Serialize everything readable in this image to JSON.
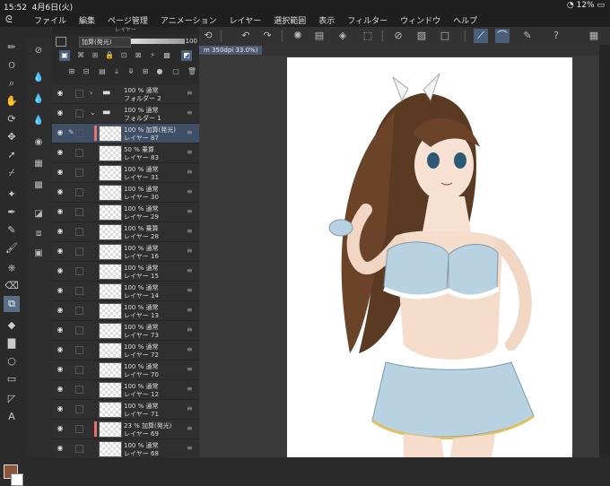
{
  "status": {
    "time": "15:52",
    "date": "4月6日(火)",
    "wifi_icon": "wifi-icon",
    "battery": "12%"
  },
  "menubar": {
    "logo_icon": "clip-studio-logo-icon",
    "items": [
      "ファイル",
      "編集",
      "ページ管理",
      "アニメーション",
      "レイヤー",
      "選択範囲",
      "表示",
      "フィルター",
      "ウィンドウ",
      "ヘルプ"
    ]
  },
  "layer_panel": {
    "title": "レイヤー",
    "blend_mode": "加算(発光)",
    "opacity": "100"
  },
  "canvas_tab": "m 350dpi 33.0%)",
  "layers": [
    {
      "kind": "folder",
      "line1": "100 %  通常",
      "line2": "フォルダー 2",
      "indent": 0,
      "arrow": "›"
    },
    {
      "kind": "folder",
      "line1": "100 %  通常",
      "line2": "フォルダー 1",
      "indent": 0,
      "arrow": "⌄"
    },
    {
      "kind": "layer",
      "line1": "100 %  加算(発光)",
      "line2": "レイヤー 87",
      "active": true,
      "color": true
    },
    {
      "kind": "layer",
      "line1": "50 %  乗算",
      "line2": "レイヤー 83"
    },
    {
      "kind": "layer",
      "line1": "100 %  通常",
      "line2": "レイヤー 31"
    },
    {
      "kind": "layer",
      "line1": "100 %  通常",
      "line2": "レイヤー 30"
    },
    {
      "kind": "layer",
      "line1": "100 %  通常",
      "line2": "レイヤー 29"
    },
    {
      "kind": "layer",
      "line1": "100 %  乗算",
      "line2": "レイヤー 28"
    },
    {
      "kind": "layer",
      "line1": "100 %  通常",
      "line2": "レイヤー 16"
    },
    {
      "kind": "layer",
      "line1": "100 %  通常",
      "line2": "レイヤー 15"
    },
    {
      "kind": "layer",
      "line1": "100 %  通常",
      "line2": "レイヤー 14"
    },
    {
      "kind": "layer",
      "line1": "100 %  通常",
      "line2": "レイヤー 13"
    },
    {
      "kind": "layer",
      "line1": "100 %  通常",
      "line2": "レイヤー 73"
    },
    {
      "kind": "layer",
      "line1": "100 %  通常",
      "line2": "レイヤー 72"
    },
    {
      "kind": "layer",
      "line1": "100 %  通常",
      "line2": "レイヤー 70"
    },
    {
      "kind": "layer",
      "line1": "100 %  通常",
      "line2": "レイヤー 12"
    },
    {
      "kind": "layer",
      "line1": "100 %  通常",
      "line2": "レイヤー 71"
    },
    {
      "kind": "layer",
      "line1": "23 %  加算(発光)",
      "line2": "レイヤー 69",
      "color": true
    },
    {
      "kind": "layer",
      "line1": "100 %  通常",
      "line2": "レイヤー 68"
    }
  ],
  "colors": {
    "main": "#8a5538",
    "sub": "#ffffff",
    "accent": "#4a5f7a"
  }
}
